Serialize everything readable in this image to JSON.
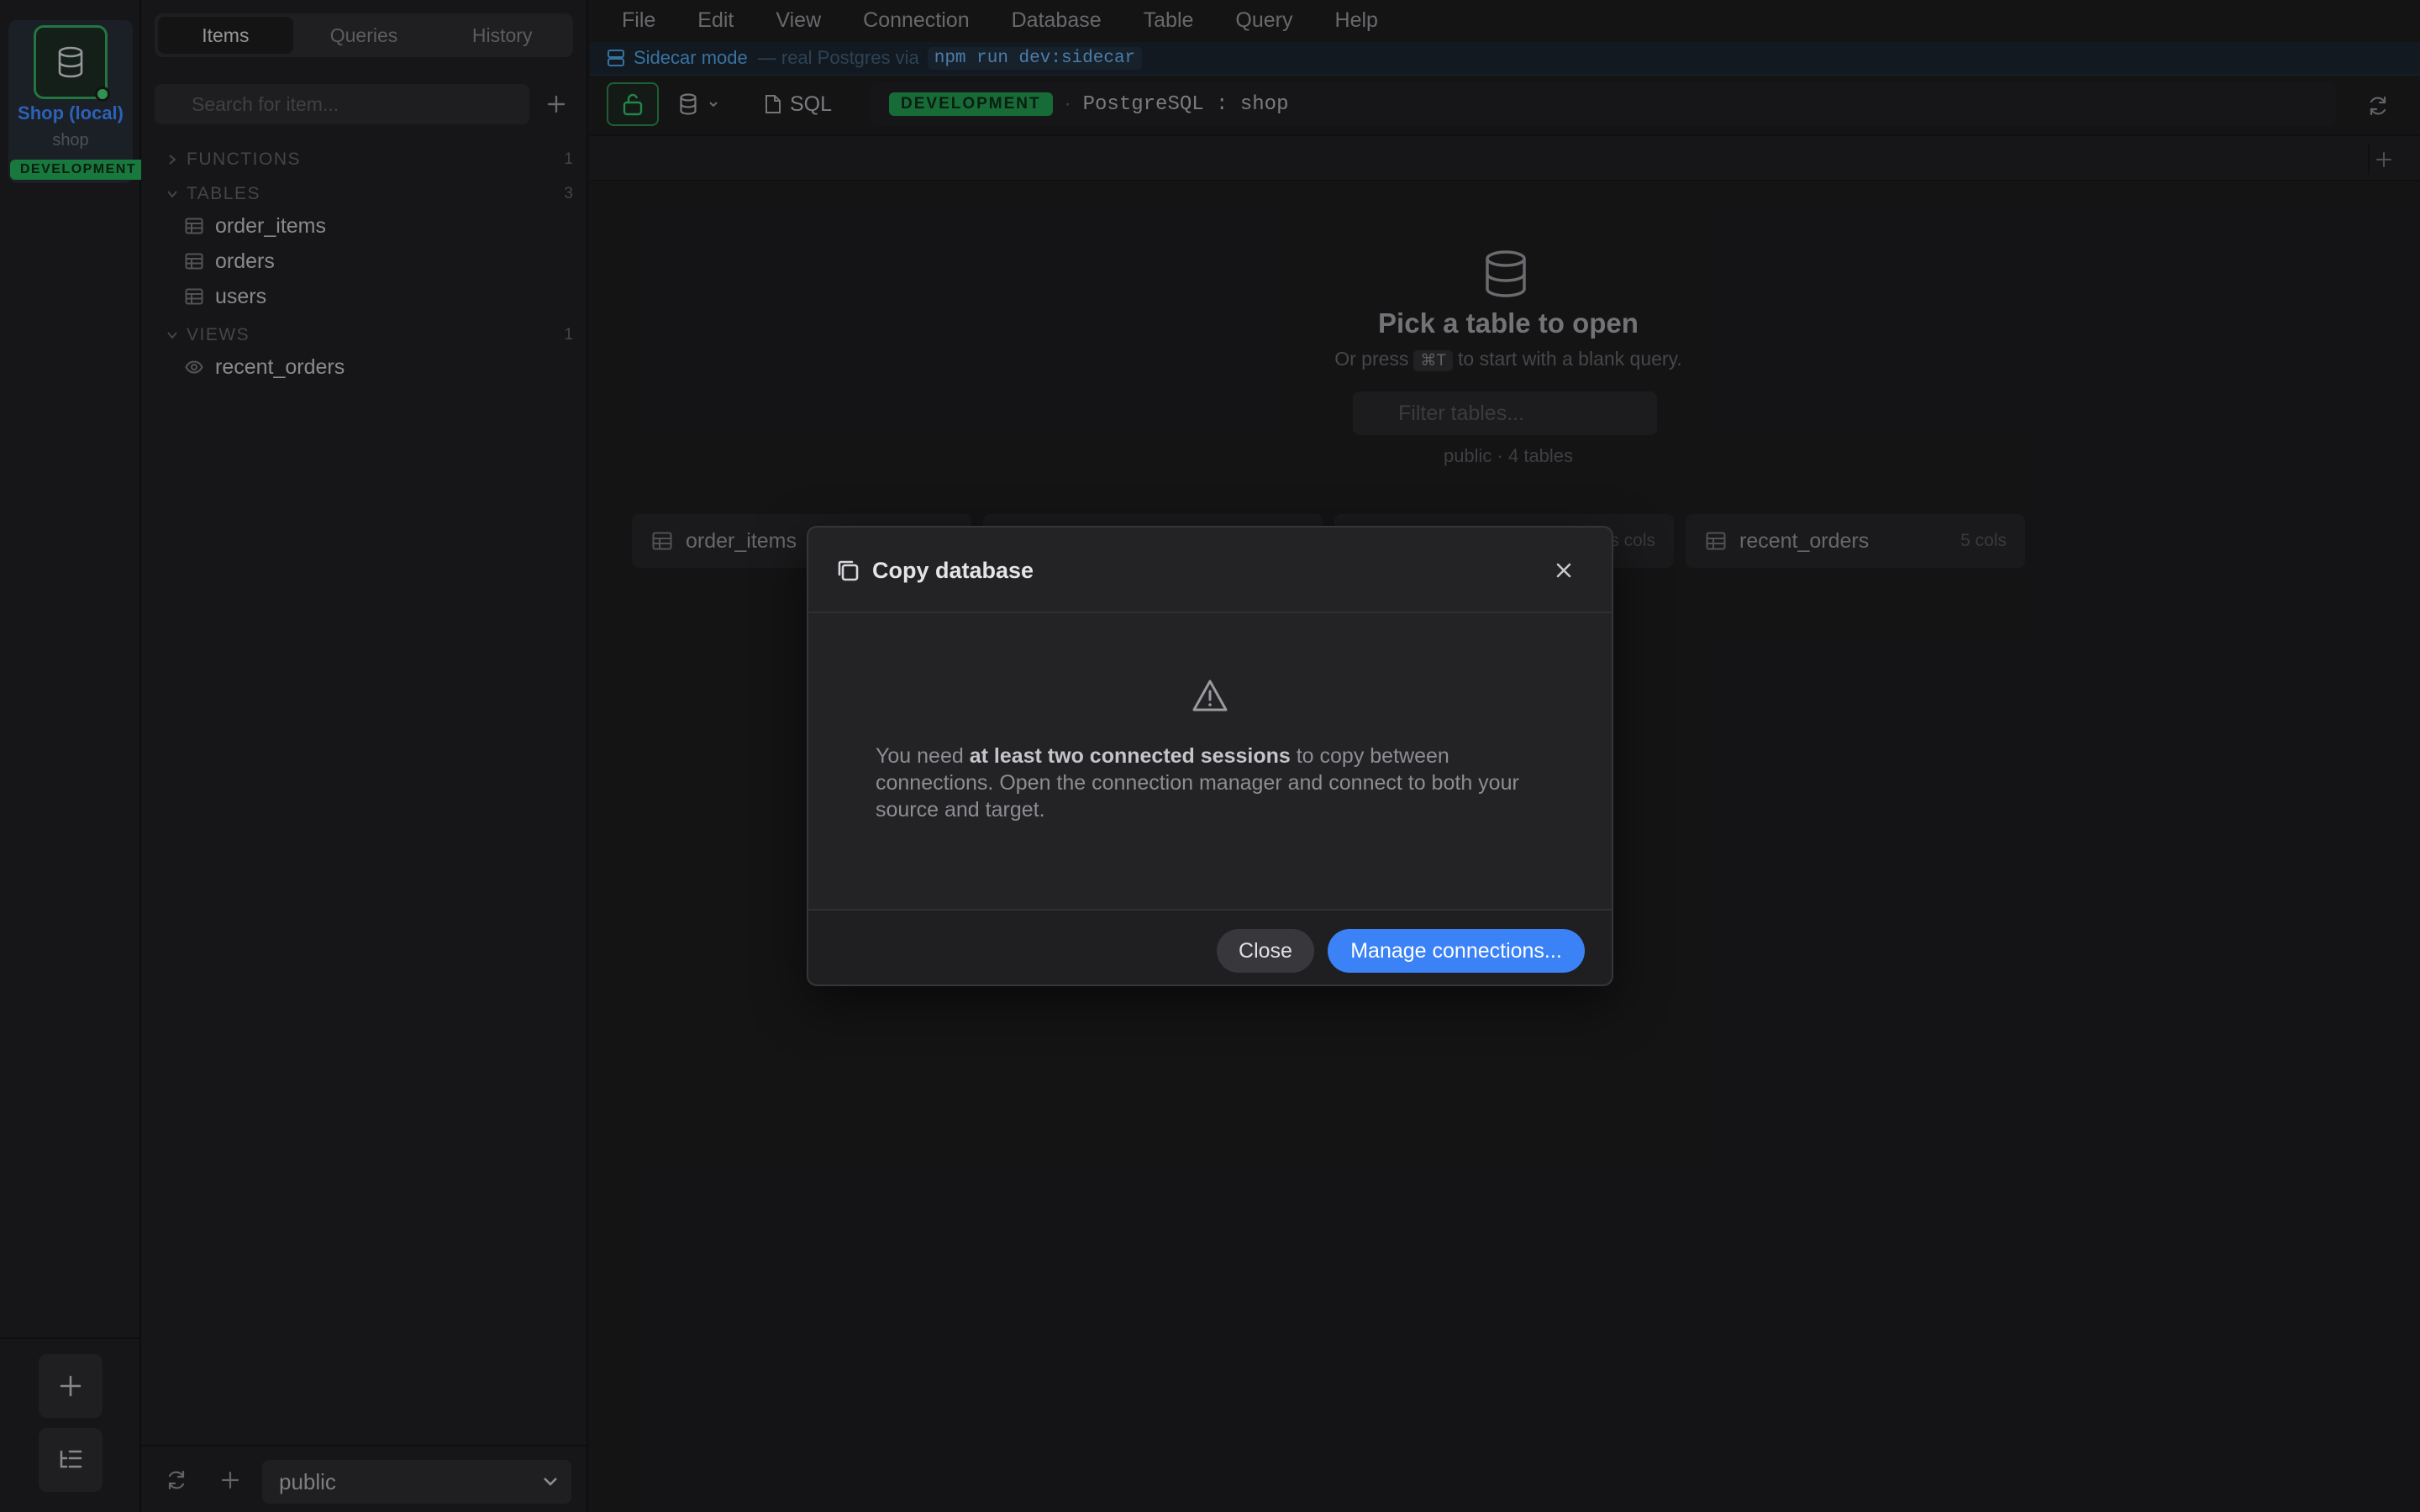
{
  "connection": {
    "name": "Shop (local)",
    "database": "shop",
    "environment": "DEVELOPMENT",
    "icon": "database-icon"
  },
  "sidebar": {
    "tabs": [
      {
        "label": "Items",
        "active": true
      },
      {
        "label": "Queries",
        "active": false
      },
      {
        "label": "History",
        "active": false
      }
    ],
    "search_placeholder": "Search for item...",
    "sections": [
      {
        "label": "FUNCTIONS",
        "count": "1",
        "expanded": false,
        "items": []
      },
      {
        "label": "TABLES",
        "count": "3",
        "expanded": true,
        "items": [
          "order_items",
          "orders",
          "users"
        ]
      },
      {
        "label": "VIEWS",
        "count": "1",
        "expanded": true,
        "items": [
          "recent_orders"
        ]
      }
    ],
    "schema": "public"
  },
  "menu": [
    "File",
    "Edit",
    "View",
    "Connection",
    "Database",
    "Table",
    "Query",
    "Help"
  ],
  "sidecar": {
    "mode": "Sidecar mode",
    "text": "— real Postgres via",
    "command": "npm run dev:sidecar"
  },
  "toolbar": {
    "sql_label": "SQL",
    "env_pill": "DEVELOPMENT",
    "separator": "·",
    "connection_label": "PostgreSQL : shop"
  },
  "empty_state": {
    "title": "Pick a table to open",
    "sub_prefix": "Or press",
    "shortcut": "⌘T",
    "sub_suffix": "to start with a blank query.",
    "filter_placeholder": "Filter tables...",
    "schema_info": "public · 4 tables",
    "cards": [
      {
        "name": "order_items",
        "cols": "",
        "icon": "table-icon"
      },
      {
        "name": "",
        "cols": "",
        "icon": ""
      },
      {
        "name": "",
        "cols": "s cols",
        "icon": ""
      },
      {
        "name": "recent_orders",
        "cols": "5 cols",
        "icon": "table-icon"
      }
    ]
  },
  "modal": {
    "title": "Copy database",
    "msg_before": "You need ",
    "msg_bold": "at least two connected sessions",
    "msg_after": " to copy between connections. Open the connection manager and connect to both your source and target.",
    "close_label": "Close",
    "manage_label": "Manage connections..."
  },
  "colors": {
    "accent": "#3b82f6",
    "dev_green": "#21a152",
    "background": "#1b1b1d"
  }
}
